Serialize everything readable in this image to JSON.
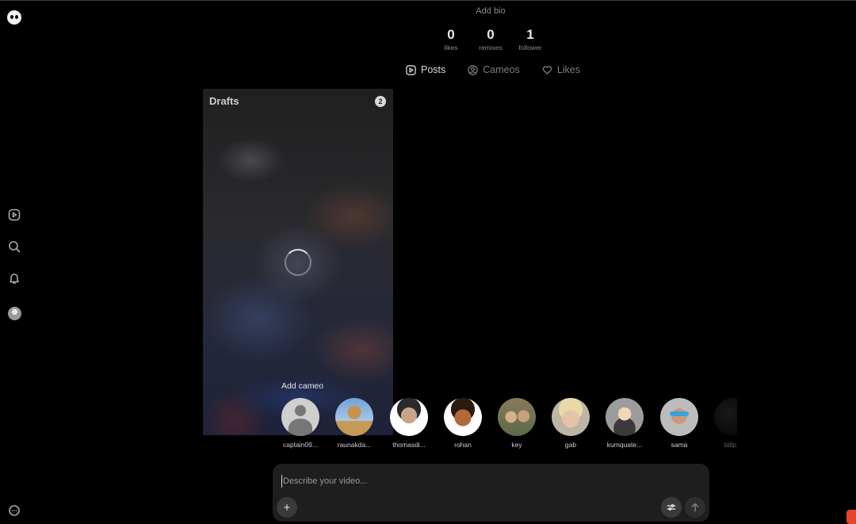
{
  "profile": {
    "bio_placeholder": "Add bio",
    "stats": [
      {
        "value": "0",
        "label": "likes"
      },
      {
        "value": "0",
        "label": "remixes"
      },
      {
        "value": "1",
        "label": "follower"
      }
    ],
    "tabs": [
      {
        "label": "Posts",
        "active": true
      },
      {
        "label": "Cameos",
        "active": false
      },
      {
        "label": "Likes",
        "active": false
      }
    ]
  },
  "drafts": {
    "title": "Drafts",
    "count": "2"
  },
  "cameo": {
    "label": "Add cameo",
    "people": [
      "captain09...",
      "raunakda...",
      "thomasdi...",
      "rohan",
      "key",
      "gab",
      "kumquate...",
      "sama",
      "billp..."
    ]
  },
  "composer": {
    "placeholder": "Describe your video...",
    "add_label": "+"
  },
  "sidebar": {
    "icons": [
      "logo-icon",
      "feed-icon",
      "search-icon",
      "bell-icon",
      "avatar",
      "more-icon"
    ]
  },
  "colors": {
    "background": "#000000",
    "composer_bg": "#1e1e1e",
    "badge": "#e8442a"
  }
}
